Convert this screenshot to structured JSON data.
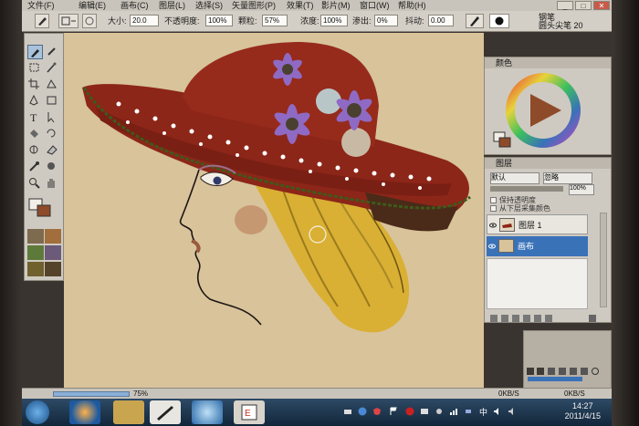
{
  "menu": {
    "items": [
      "文件(F)",
      "编辑(E)",
      "画布(C)",
      "图层(L)",
      "选择(S)",
      "矢量图形(P)",
      "效果(T)",
      "影片(M)",
      "窗口(W)",
      "帮助(H)"
    ]
  },
  "window_controls": {
    "minimize": "_",
    "restore": "□",
    "close": "✕"
  },
  "property_bar": {
    "size_label": "大小:",
    "size_value": "20.0",
    "opacity_label": "不透明度:",
    "opacity_value": "100%",
    "grain_label": "颗粒:",
    "grain_value": "57%",
    "density_label": "浓度:",
    "density_value": "100%",
    "bleed_label": "渗出:",
    "bleed_value": "0%",
    "jitter_label": "抖动:",
    "jitter_value": "0.00",
    "brush_category": "钢笔",
    "brush_variant": "圆头尖笔 20"
  },
  "panels": {
    "color_title": "颜色",
    "layers_title": "图层",
    "composite_method": "默认",
    "composite_depth": "忽略",
    "layer_opacity": "100%",
    "preserve_transparency": "保持透明度",
    "pick_up_underlying": "从下层采集颜色",
    "layers": [
      {
        "name": "图层 1",
        "selected": false
      },
      {
        "name": "画布",
        "selected": true
      }
    ]
  },
  "status": {
    "zoom": "75%",
    "net_down": "0KB/S",
    "net_up": "0KB/S"
  },
  "taskbar": {
    "time": "14:27",
    "date": "2011/4/15"
  },
  "colors": {
    "background": "#d8c39b",
    "hat": "#8c2618",
    "hair": "#d9b033",
    "skin_blush": "#b7744e",
    "flower": "#8f6ac4",
    "accent_blue": "#3a72b8"
  }
}
